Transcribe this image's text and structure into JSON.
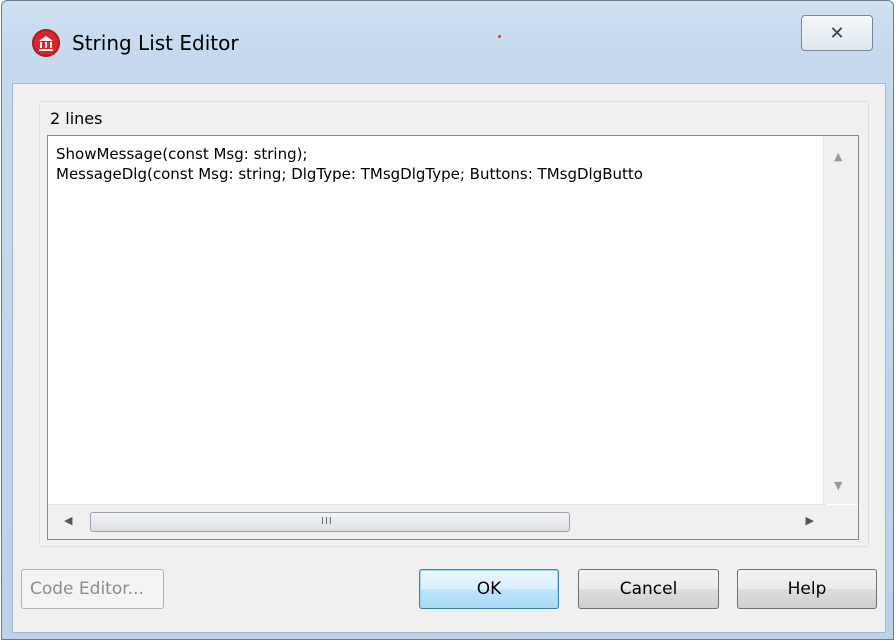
{
  "window": {
    "title": "String List Editor",
    "close_glyph": "✕"
  },
  "editor": {
    "line_count_label": "2 lines",
    "lines": [
      "ShowMessage(const Msg: string);",
      "MessageDlg(const Msg: string; DlgType: TMsgDlgType; Buttons: TMsgDlgButto"
    ]
  },
  "scrollbar": {
    "grip": "III"
  },
  "buttons": {
    "code_editor": "Code Editor...",
    "ok": "OK",
    "cancel": "Cancel",
    "help": "Help"
  },
  "colors": {
    "app_icon": "#d8272c",
    "ok_border": "#3c7fb1"
  },
  "icons": {
    "app": "app-icon",
    "close": "close-icon"
  }
}
